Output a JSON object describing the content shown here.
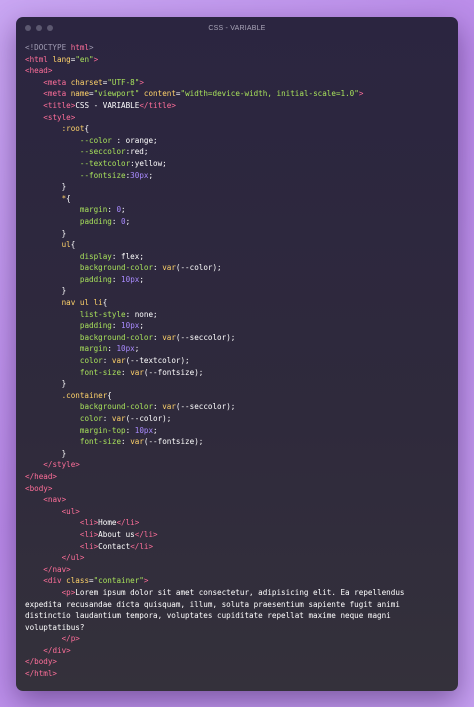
{
  "window": {
    "title": "CSS - VARIABLE"
  },
  "lines": [
    [
      [
        "c",
        "<!DOCTYPE "
      ],
      [
        "t",
        "html"
      ],
      [
        "c",
        ">"
      ]
    ],
    [
      [
        "t",
        "<html "
      ],
      [
        "a",
        "lang"
      ],
      [
        "txt",
        "="
      ],
      [
        "s",
        "\"en\""
      ],
      [
        "t",
        ">"
      ]
    ],
    [
      [
        "t",
        "<head>"
      ]
    ],
    [
      [
        "txt",
        "    "
      ],
      [
        "t",
        "<meta "
      ],
      [
        "a",
        "charset"
      ],
      [
        "txt",
        "="
      ],
      [
        "s",
        "\"UTF-8\""
      ],
      [
        "t",
        ">"
      ]
    ],
    [
      [
        "txt",
        "    "
      ],
      [
        "t",
        "<meta "
      ],
      [
        "a",
        "name"
      ],
      [
        "txt",
        "="
      ],
      [
        "s",
        "\"viewport\""
      ],
      [
        "txt",
        " "
      ],
      [
        "a",
        "content"
      ],
      [
        "txt",
        "="
      ],
      [
        "s",
        "\"width=device-width, initial-scale=1.0\""
      ],
      [
        "t",
        ">"
      ]
    ],
    [
      [
        "txt",
        "    "
      ],
      [
        "t",
        "<title>"
      ],
      [
        "txt",
        "CSS - VARIABLE"
      ],
      [
        "t",
        "</title>"
      ]
    ],
    [
      [
        "txt",
        "    "
      ],
      [
        "t",
        "<style>"
      ]
    ],
    [
      [
        "txt",
        "        "
      ],
      [
        "a",
        ":root"
      ],
      [
        "txt",
        "{"
      ]
    ],
    [
      [
        "txt",
        "            "
      ],
      [
        "s",
        "--color"
      ],
      [
        "txt",
        " : orange;"
      ]
    ],
    [
      [
        "txt",
        "            "
      ],
      [
        "s",
        "--seccolor"
      ],
      [
        "txt",
        ":red;"
      ]
    ],
    [
      [
        "txt",
        "            "
      ],
      [
        "s",
        "--textcolor"
      ],
      [
        "txt",
        ":yellow;"
      ]
    ],
    [
      [
        "txt",
        "            "
      ],
      [
        "s",
        "--fontsize"
      ],
      [
        "txt",
        ":"
      ],
      [
        "p",
        "30px"
      ],
      [
        "txt",
        ";"
      ]
    ],
    [
      [
        "txt",
        "        }"
      ]
    ],
    [
      [
        "txt",
        "        "
      ],
      [
        "a",
        "*"
      ],
      [
        "txt",
        "{"
      ]
    ],
    [
      [
        "txt",
        "            "
      ],
      [
        "s",
        "margin"
      ],
      [
        "txt",
        ": "
      ],
      [
        "p",
        "0"
      ],
      [
        "txt",
        ";"
      ]
    ],
    [
      [
        "txt",
        "            "
      ],
      [
        "s",
        "padding"
      ],
      [
        "txt",
        ": "
      ],
      [
        "p",
        "0"
      ],
      [
        "txt",
        ";"
      ]
    ],
    [
      [
        "txt",
        "        }"
      ]
    ],
    [
      [
        "txt",
        "        "
      ],
      [
        "a",
        "ul"
      ],
      [
        "txt",
        "{"
      ]
    ],
    [
      [
        "txt",
        "            "
      ],
      [
        "s",
        "display"
      ],
      [
        "txt",
        ": flex;"
      ]
    ],
    [
      [
        "txt",
        "            "
      ],
      [
        "s",
        "background-color"
      ],
      [
        "txt",
        ": "
      ],
      [
        "a",
        "var"
      ],
      [
        "txt",
        "(--color);"
      ]
    ],
    [
      [
        "txt",
        "            "
      ],
      [
        "s",
        "padding"
      ],
      [
        "txt",
        ": "
      ],
      [
        "p",
        "10px"
      ],
      [
        "txt",
        ";"
      ]
    ],
    [
      [
        "txt",
        "        }"
      ]
    ],
    [
      [
        "txt",
        "        "
      ],
      [
        "a",
        "nav ul li"
      ],
      [
        "txt",
        "{"
      ]
    ],
    [
      [
        "txt",
        "            "
      ],
      [
        "s",
        "list-style"
      ],
      [
        "txt",
        ": none;"
      ]
    ],
    [
      [
        "txt",
        "            "
      ],
      [
        "s",
        "padding"
      ],
      [
        "txt",
        ": "
      ],
      [
        "p",
        "10px"
      ],
      [
        "txt",
        ";"
      ]
    ],
    [
      [
        "txt",
        "            "
      ],
      [
        "s",
        "background-color"
      ],
      [
        "txt",
        ": "
      ],
      [
        "a",
        "var"
      ],
      [
        "txt",
        "(--seccolor);"
      ]
    ],
    [
      [
        "txt",
        "            "
      ],
      [
        "s",
        "margin"
      ],
      [
        "txt",
        ": "
      ],
      [
        "p",
        "10px"
      ],
      [
        "txt",
        ";"
      ]
    ],
    [
      [
        "txt",
        "            "
      ],
      [
        "s",
        "color"
      ],
      [
        "txt",
        ": "
      ],
      [
        "a",
        "var"
      ],
      [
        "txt",
        "(--textcolor);"
      ]
    ],
    [
      [
        "txt",
        "            "
      ],
      [
        "s",
        "font-size"
      ],
      [
        "txt",
        ": "
      ],
      [
        "a",
        "var"
      ],
      [
        "txt",
        "(--fontsize);"
      ]
    ],
    [
      [
        "txt",
        "        }"
      ]
    ],
    [
      [
        "txt",
        "        "
      ],
      [
        "a",
        ".container"
      ],
      [
        "txt",
        "{"
      ]
    ],
    [
      [
        "txt",
        "            "
      ],
      [
        "s",
        "background-color"
      ],
      [
        "txt",
        ": "
      ],
      [
        "a",
        "var"
      ],
      [
        "txt",
        "(--seccolor);"
      ]
    ],
    [
      [
        "txt",
        "            "
      ],
      [
        "s",
        "color"
      ],
      [
        "txt",
        ": "
      ],
      [
        "a",
        "var"
      ],
      [
        "txt",
        "(--color);"
      ]
    ],
    [
      [
        "txt",
        "            "
      ],
      [
        "s",
        "margin-top"
      ],
      [
        "txt",
        ": "
      ],
      [
        "p",
        "10px"
      ],
      [
        "txt",
        ";"
      ]
    ],
    [
      [
        "txt",
        "            "
      ],
      [
        "s",
        "font-size"
      ],
      [
        "txt",
        ": "
      ],
      [
        "a",
        "var"
      ],
      [
        "txt",
        "(--fontsize);"
      ]
    ],
    [
      [
        "txt",
        "        }"
      ]
    ],
    [
      [
        "txt",
        "    "
      ],
      [
        "t",
        "</style>"
      ]
    ],
    [
      [
        "t",
        "</head>"
      ]
    ],
    [
      [
        "t",
        "<body>"
      ]
    ],
    [
      [
        "txt",
        "    "
      ],
      [
        "t",
        "<nav>"
      ]
    ],
    [
      [
        "txt",
        "        "
      ],
      [
        "t",
        "<ul>"
      ]
    ],
    [
      [
        "txt",
        "            "
      ],
      [
        "t",
        "<li>"
      ],
      [
        "txt",
        "Home"
      ],
      [
        "t",
        "</li>"
      ]
    ],
    [
      [
        "txt",
        "            "
      ],
      [
        "t",
        "<li>"
      ],
      [
        "txt",
        "About us"
      ],
      [
        "t",
        "</li>"
      ]
    ],
    [
      [
        "txt",
        "            "
      ],
      [
        "t",
        "<li>"
      ],
      [
        "txt",
        "Contact"
      ],
      [
        "t",
        "</li>"
      ]
    ],
    [
      [
        "txt",
        "        "
      ],
      [
        "t",
        "</ul>"
      ]
    ],
    [
      [
        "txt",
        "    "
      ],
      [
        "t",
        "</nav>"
      ]
    ],
    [
      [
        "txt",
        "    "
      ],
      [
        "t",
        "<div "
      ],
      [
        "a",
        "class"
      ],
      [
        "txt",
        "="
      ],
      [
        "s",
        "\"container\""
      ],
      [
        "t",
        ">"
      ]
    ],
    [
      [
        "txt",
        "        "
      ],
      [
        "t",
        "<p>"
      ],
      [
        "txt",
        "Lorem ipsum dolor sit amet consectetur, adipisicing elit. Ea repellendus"
      ]
    ],
    [
      [
        "txt",
        "expedita recusandae dicta quisquam, illum, soluta praesentium sapiente fugit animi"
      ]
    ],
    [
      [
        "txt",
        "distinctio laudantium tempora, voluptates cupiditate repellat maxime neque magni"
      ]
    ],
    [
      [
        "txt",
        "voluptatibus?"
      ]
    ],
    [
      [
        "txt",
        "        "
      ],
      [
        "t",
        "</p>"
      ]
    ],
    [
      [
        "txt",
        "    "
      ],
      [
        "t",
        "</div>"
      ]
    ],
    [
      [
        "t",
        "</body>"
      ]
    ],
    [
      [
        "t",
        "</html>"
      ]
    ]
  ]
}
